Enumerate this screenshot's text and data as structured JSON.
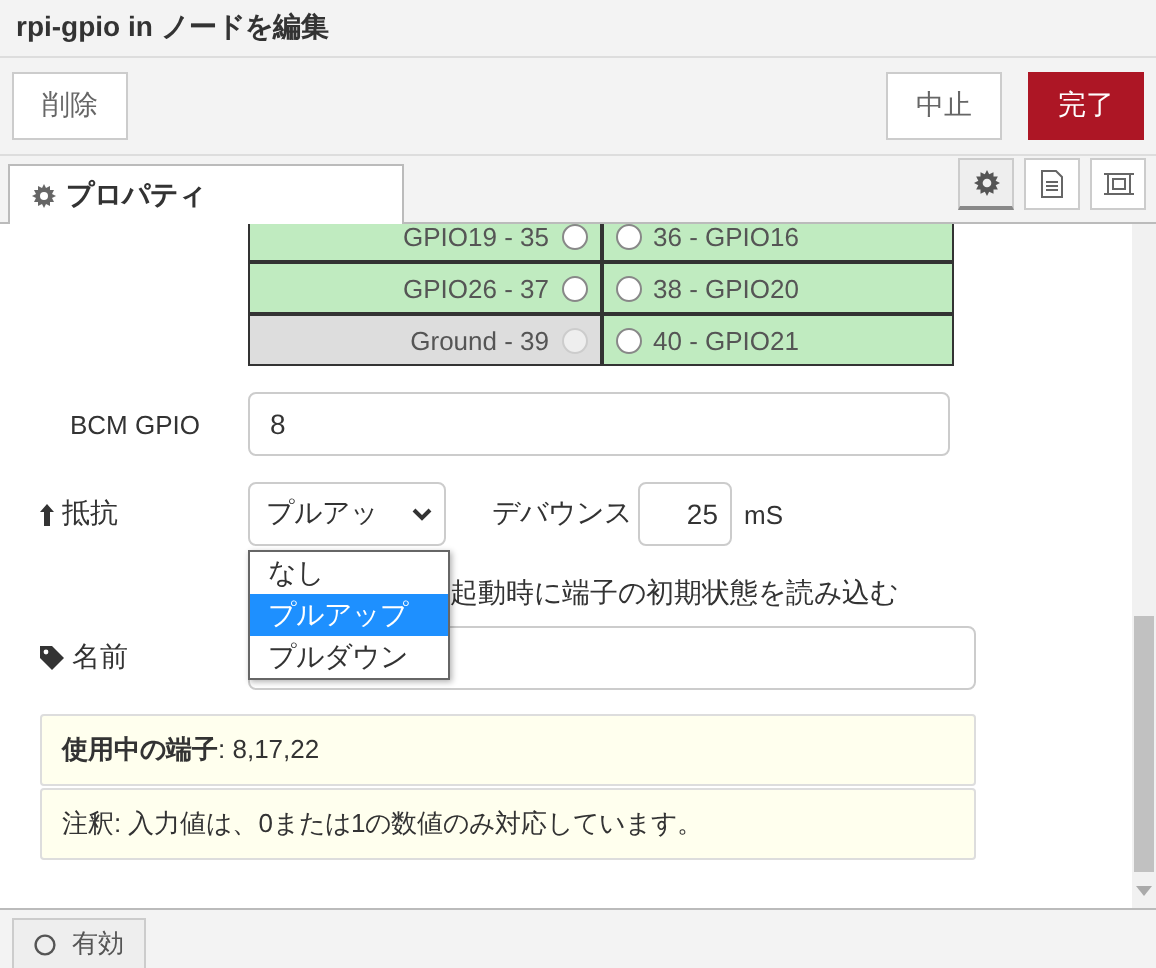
{
  "dialog": {
    "title": "rpi-gpio in ノードを編集"
  },
  "toolbar": {
    "delete": "削除",
    "cancel": "中止",
    "done": "完了"
  },
  "tabs": [
    {
      "label": "プロパティ",
      "selected": true
    }
  ],
  "tab_buttons": [
    {
      "kind": "gear",
      "selected": true
    },
    {
      "kind": "document",
      "selected": false
    },
    {
      "kind": "frame",
      "selected": false
    }
  ],
  "pins": [
    {
      "left": {
        "label": "GPIO19 - 35",
        "kind": "gpio",
        "checked": false
      },
      "right": {
        "label": "36 - GPIO16",
        "kind": "gpio",
        "checked": false
      }
    },
    {
      "left": {
        "label": "GPIO26 - 37",
        "kind": "gpio",
        "checked": false
      },
      "right": {
        "label": "38 - GPIO20",
        "kind": "gpio",
        "checked": false
      }
    },
    {
      "left": {
        "label": "Ground - 39",
        "kind": "ground",
        "checked": false
      },
      "right": {
        "label": "40 - GPIO21",
        "kind": "gpio",
        "checked": false
      }
    }
  ],
  "bcm_gpio": {
    "label": "BCM GPIO",
    "value": "8"
  },
  "resistor": {
    "label": "抵抗",
    "value": "プルアッ",
    "options": [
      {
        "label": "なし",
        "selected": false
      },
      {
        "label": "プルアップ",
        "selected": true
      },
      {
        "label": "プルダウン",
        "selected": false
      }
    ]
  },
  "debounce": {
    "label": "デバウンス",
    "value": "25",
    "unit": "mS"
  },
  "read_initial": {
    "label": "起動時に端子の初期状態を読み込む"
  },
  "name": {
    "label": "名前"
  },
  "info": [
    {
      "text": "**使用中の端子**: 8,17,22"
    },
    {
      "text": "注釈: 入力値は、0または1の数値のみ対応しています。"
    }
  ],
  "footer": {
    "enabled": "有効"
  }
}
